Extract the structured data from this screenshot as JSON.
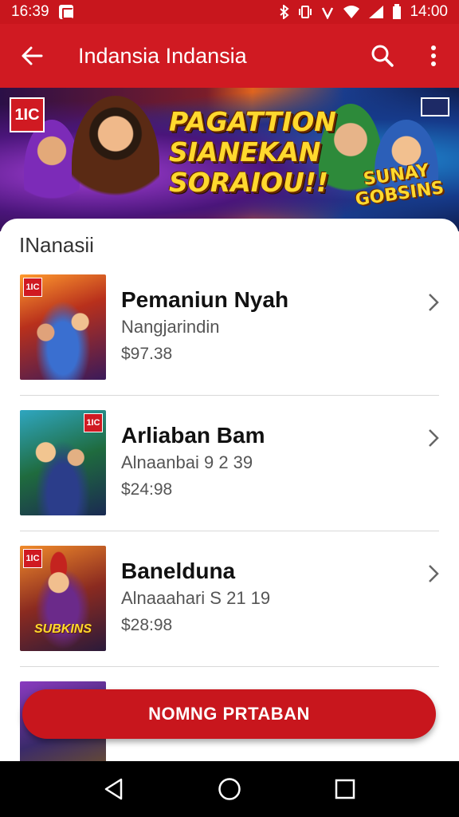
{
  "status_bar": {
    "left_time": "16:39",
    "right_time": "14:00"
  },
  "app_bar": {
    "title": "Indansia Indansia"
  },
  "banner": {
    "logo_text": "1IC",
    "headline": "PAGATTION SIANEKAN SORAIOU!!",
    "sub_text": "SUNAY GOBSINS"
  },
  "section": {
    "title": "INanasii"
  },
  "items": [
    {
      "title": "Pemaniun Nyah",
      "subtitle": "Nangjarindin",
      "price": "$97.38",
      "badge": "1IC",
      "caption": ""
    },
    {
      "title": "Arliaban Bam",
      "subtitle": "Alnaanbai 9 2 39",
      "price": "$24:98",
      "badge": "1IC",
      "caption": ""
    },
    {
      "title": "Banelduna",
      "subtitle": "Alnaaahari S 21 19",
      "price": "$28:98",
      "badge": "1IC",
      "caption": "SUBKINS"
    }
  ],
  "cta": {
    "label": "NOMNG PRTABAN"
  },
  "colors": {
    "primary": "#d01a22",
    "status": "#c8161d"
  }
}
